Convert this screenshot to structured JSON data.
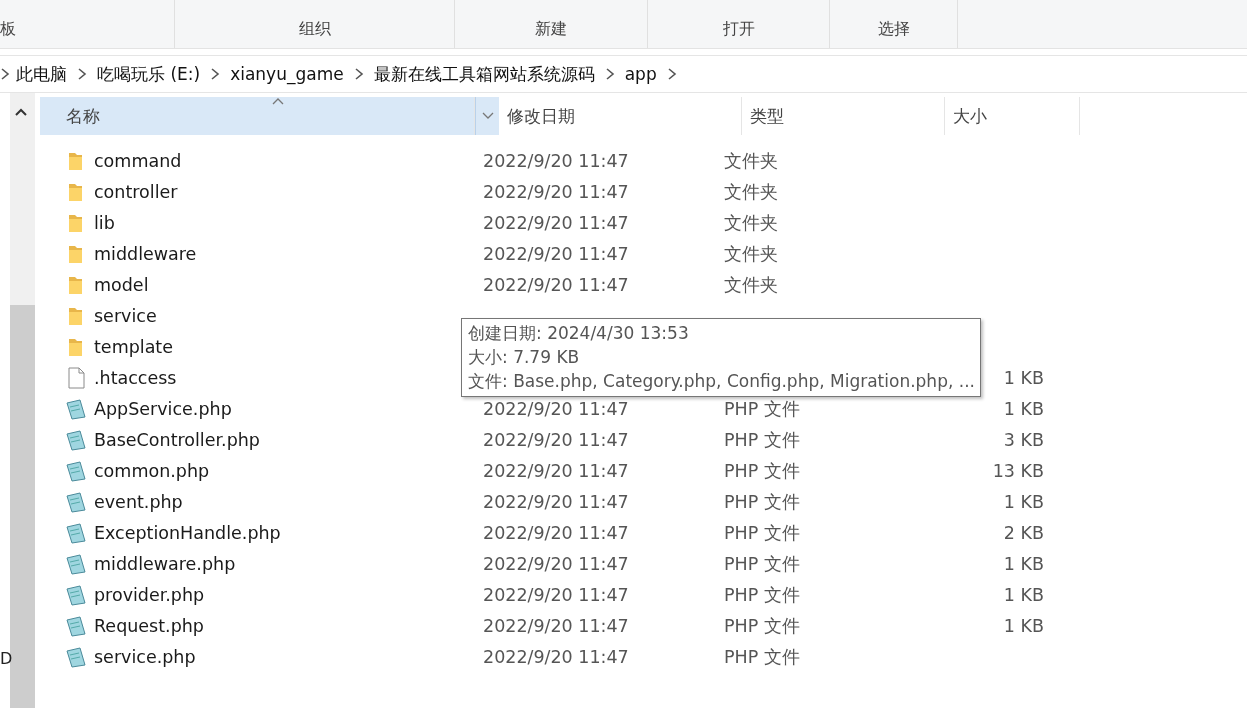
{
  "ribbon": {
    "groups": [
      "板",
      "组织",
      "新建",
      "打开",
      "选择"
    ]
  },
  "breadcrumb": [
    "此电脑",
    "吃喝玩乐 (E:)",
    "xianyu_game",
    "最新在线工具箱网站系统源码",
    "app"
  ],
  "nav_pane": {
    "fragment": "D"
  },
  "table": {
    "columns": [
      "名称",
      "修改日期",
      "类型",
      "大小"
    ],
    "rows": [
      {
        "kind": "folder",
        "name": "command",
        "date": "2022/9/20 11:47",
        "type": "文件夹"
      },
      {
        "kind": "folder",
        "name": "controller",
        "date": "2022/9/20 11:47",
        "type": "文件夹"
      },
      {
        "kind": "folder",
        "name": "lib",
        "date": "2022/9/20 11:47",
        "type": "文件夹"
      },
      {
        "kind": "folder",
        "name": "middleware",
        "date": "2022/9/20 11:47",
        "type": "文件夹"
      },
      {
        "kind": "folder",
        "name": "model",
        "date": "2022/9/20 11:47",
        "type": "文件夹"
      },
      {
        "kind": "folder",
        "name": "service"
      },
      {
        "kind": "folder",
        "name": "template"
      },
      {
        "kind": "file",
        "name": ".htaccess",
        "size": "1 KB"
      },
      {
        "kind": "php",
        "name": "AppService.php",
        "date": "2022/9/20 11:47",
        "type": "PHP 文件",
        "size": "1 KB"
      },
      {
        "kind": "php",
        "name": "BaseController.php",
        "date": "2022/9/20 11:47",
        "type": "PHP 文件",
        "size": "3 KB"
      },
      {
        "kind": "php",
        "name": "common.php",
        "date": "2022/9/20 11:47",
        "type": "PHP 文件",
        "size": "13 KB"
      },
      {
        "kind": "php",
        "name": "event.php",
        "date": "2022/9/20 11:47",
        "type": "PHP 文件",
        "size": "1 KB"
      },
      {
        "kind": "php",
        "name": "ExceptionHandle.php",
        "date": "2022/9/20 11:47",
        "type": "PHP 文件",
        "size": "2 KB"
      },
      {
        "kind": "php",
        "name": "middleware.php",
        "date": "2022/9/20 11:47",
        "type": "PHP 文件",
        "size": "1 KB"
      },
      {
        "kind": "php",
        "name": "provider.php",
        "date": "2022/9/20 11:47",
        "type": "PHP 文件",
        "size": "1 KB"
      },
      {
        "kind": "php",
        "name": "Request.php",
        "date": "2022/9/20 11:47",
        "type": "PHP 文件",
        "size": "1 KB"
      },
      {
        "kind": "php",
        "name": "service.php",
        "date": "2022/9/20 11:47",
        "type": "PHP 文件"
      }
    ]
  },
  "tooltip": {
    "lines": [
      "创建日期: 2024/4/30 13:53",
      "大小: 7.79 KB",
      "文件: Base.php, Category.php, Config.php, Migration.php, ..."
    ]
  }
}
